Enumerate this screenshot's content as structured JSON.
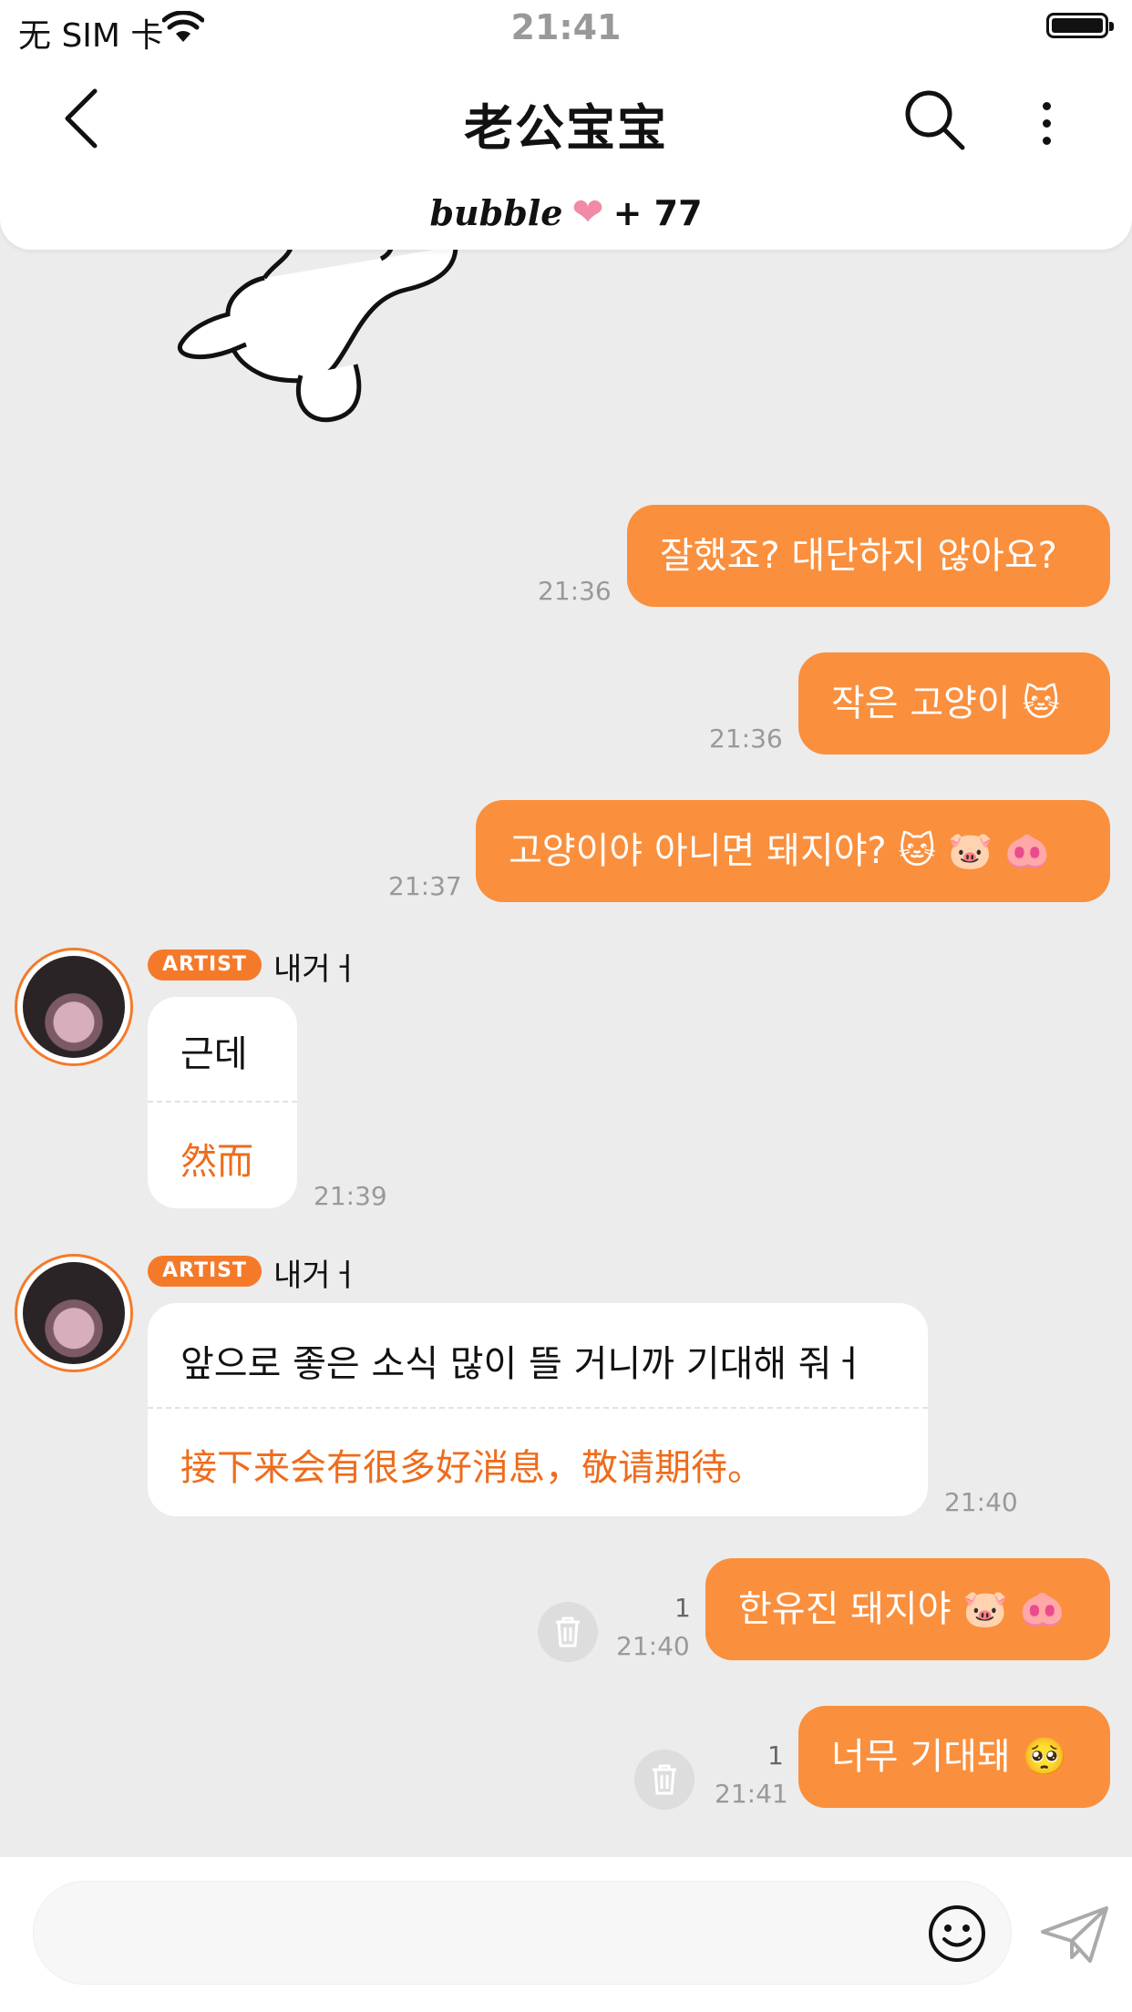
{
  "status_bar": {
    "carrier": "无 SIM 卡",
    "time": "21:41"
  },
  "header": {
    "title": "老公宝宝",
    "bubble_brand": "bubble",
    "bubble_count": "+ 77"
  },
  "colors": {
    "accent": "#fa8f3d",
    "accent_dark": "#f47a2a",
    "translation": "#ee6c1c",
    "background": "#ececec"
  },
  "messages": {
    "m1": {
      "text": "잘했죠? 대단하지 않아요?",
      "time": "21:36"
    },
    "m2": {
      "text": "작은 고양이 🐱",
      "time": "21:36"
    },
    "m3": {
      "text": "고양이야 아니면 돼지야? 🐱 🐷 🐽",
      "time": "21:37"
    },
    "m4": {
      "badge": "ARTIST",
      "sender": "내거ㅓ",
      "text": "근데",
      "translation": "然而",
      "time": "21:39"
    },
    "m5": {
      "badge": "ARTIST",
      "sender": "내거ㅓ",
      "text": "앞으로 좋은 소식 많이 뜰 거니까 기대해 줘ㅓ",
      "translation": "接下来会有很多好消息，敬请期待。",
      "time": "21:40"
    },
    "m6": {
      "text": "한유진 돼지야 🐷 🐽",
      "time": "21:40",
      "read_count": "1"
    },
    "m7": {
      "text": "너무 기대돼 🥺",
      "time": "21:41",
      "read_count": "1"
    }
  },
  "composer": {
    "placeholder": ""
  }
}
